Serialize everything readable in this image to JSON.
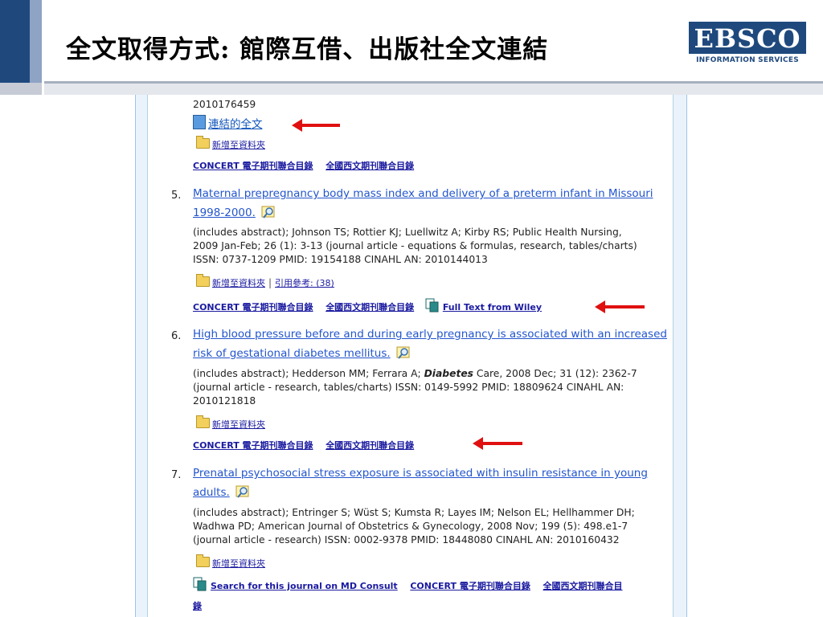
{
  "slide": {
    "title": "全文取得方式: 館際互借、出版社全文連結",
    "logo_main": "EBSCO",
    "logo_sub": "INFORMATION SERVICES"
  },
  "results": {
    "top_partial": {
      "an": "2010176459",
      "fulltext_link": "連結的全文",
      "add_folder": "新增至資料夾",
      "concert": "CONCERT 電子期刊聯合目錄",
      "national": "全國西文期刊聯合目錄"
    },
    "items": [
      {
        "number": "5.",
        "title_line1": "Maternal prepregnancy body mass index and delivery of a preterm infant in Missouri",
        "title_line2": "1998-2000.",
        "meta_line1": "(includes abstract); Johnson TS; Rottier KJ; Luellwitz A; Kirby RS; Public Health Nursing,",
        "meta_line2": "2009 Jan-Feb; 26 (1): 3-13 (journal article - equations & formulas, research, tables/charts)",
        "meta_line3": "ISSN: 0737-1209 PMID: 19154188 CINAHL AN: 2010144013",
        "add_folder": "新增至資料夾",
        "cited": "引用參考: (38)",
        "concert": "CONCERT 電子期刊聯合目錄",
        "national": "全國西文期刊聯合目錄",
        "fulltext": "Full Text from Wiley"
      },
      {
        "number": "6.",
        "title_line1": "High blood pressure before and during early pregnancy is associated with an increased",
        "title_line2": "risk of gestational diabetes mellitus.",
        "meta_line1_a": "(includes abstract); Hedderson MM; Ferrara A; ",
        "meta_line1_b": "Diabetes",
        "meta_line1_c": " Care, 2008 Dec; 31 (12): 2362-7",
        "meta_line2": "(journal article - research, tables/charts) ISSN: 0149-5992 PMID: 18809624 CINAHL AN:",
        "meta_line3": "2010121818",
        "add_folder": "新增至資料夾",
        "concert": "CONCERT 電子期刊聯合目錄",
        "national": "全國西文期刊聯合目錄"
      },
      {
        "number": "7.",
        "title_line1": "Prenatal psychosocial stress exposure is associated with insulin resistance in young",
        "title_line2": "adults.",
        "meta_line1": "(includes abstract); Entringer S; Wüst S; Kumsta R; Layes IM; Nelson EL; Hellhammer DH;",
        "meta_line2": "Wadhwa PD; American Journal of Obstetrics & Gynecology, 2008 Nov; 199 (5): 498.e1-7",
        "meta_line3": "(journal article - research) ISSN: 0002-9378 PMID: 18448080 CINAHL AN: 2010160432",
        "add_folder": "新增至資料夾",
        "md_consult": "Search for this journal on MD Consult",
        "concert": "CONCERT 電子期刊聯合目錄",
        "national_a": "全國西文期刊聯合目",
        "national_b": "錄"
      }
    ]
  },
  "colors": {
    "brand": "#1f497d",
    "arrow": "#e01010",
    "link": "#2255cc"
  },
  "icons": [
    "folder-icon",
    "magnifier-icon",
    "document-icon",
    "fulltext-icon",
    "arrow-icon"
  ]
}
